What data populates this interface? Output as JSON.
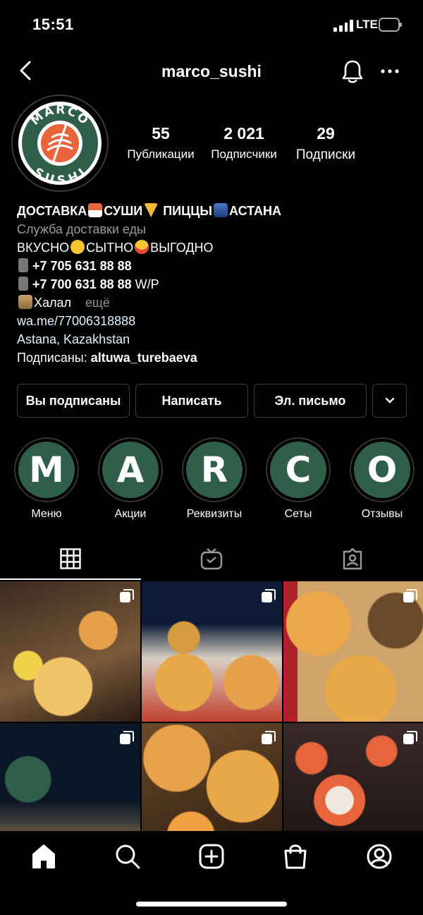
{
  "status_bar": {
    "time": "15:51",
    "network": "LTE"
  },
  "header": {
    "username": "marco_sushi"
  },
  "profile": {
    "logo_top": "MARCO",
    "logo_bottom": "SUSHI",
    "stats": [
      {
        "value": "55",
        "label": "Публикации"
      },
      {
        "value": "2 021",
        "label": "Подписчики"
      },
      {
        "value": "29",
        "label": "Подписки"
      }
    ]
  },
  "bio": {
    "line1_a": "ДОСТАВКА",
    "line1_b": "СУШИ",
    "line1_c": " ПИЦЦЫ",
    "line1_d": "АСТАНА",
    "category": "Служба доставки еды",
    "line3_a": "ВКУСНО",
    "line3_b": "СЫТНО",
    "line3_c": "ВЫГОДНО",
    "phone1": "+7 705 631 88 88",
    "phone2": "+7 700 631 88 88",
    "phone2_suffix": " W/P",
    "halal": "Халал",
    "more": "ещё",
    "link": "wa.me/77006318888",
    "location": "Astana, Kazakhstan",
    "followed_by_label": "Подписаны: ",
    "followed_by_user": "altuwa_turebaeva"
  },
  "buttons": {
    "following": "Вы подписаны",
    "message": "Написать",
    "email": "Эл. письмо"
  },
  "highlights": [
    {
      "letter": "M",
      "label": "Меню"
    },
    {
      "letter": "A",
      "label": "Акции"
    },
    {
      "letter": "R",
      "label": "Реквизиты"
    },
    {
      "letter": "C",
      "label": "Сеты"
    },
    {
      "letter": "O",
      "label": "Отзывы"
    }
  ],
  "tabs": [
    "grid-icon",
    "igtv-icon",
    "tagged-icon"
  ],
  "colors": {
    "highlight_green": "#2f5f4b",
    "logo_orange": "#e8643a"
  }
}
